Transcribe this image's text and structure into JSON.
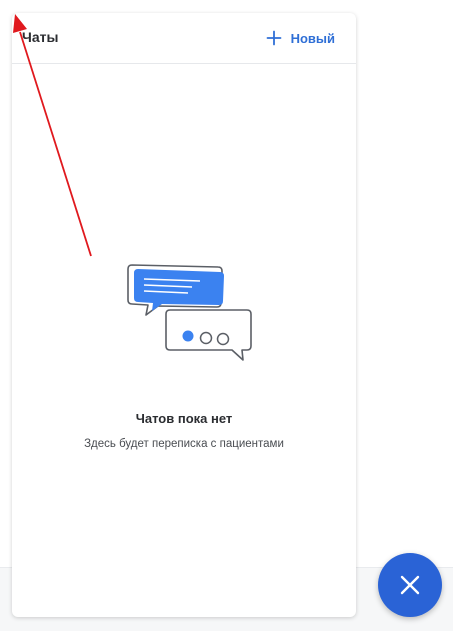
{
  "chat_panel": {
    "title": "Чаты",
    "new_button_label": "Новый",
    "new_button_icon": "plus-icon"
  },
  "empty_state": {
    "title": "Чатов пока нет",
    "subtitle": "Здесь будет переписка с пациентами",
    "illustration": "chat-bubbles-icon"
  },
  "fab": {
    "icon": "close-icon",
    "color": "#2a63d6"
  },
  "colors": {
    "accent": "#2f6fd6",
    "annotation": "#e0191e"
  }
}
